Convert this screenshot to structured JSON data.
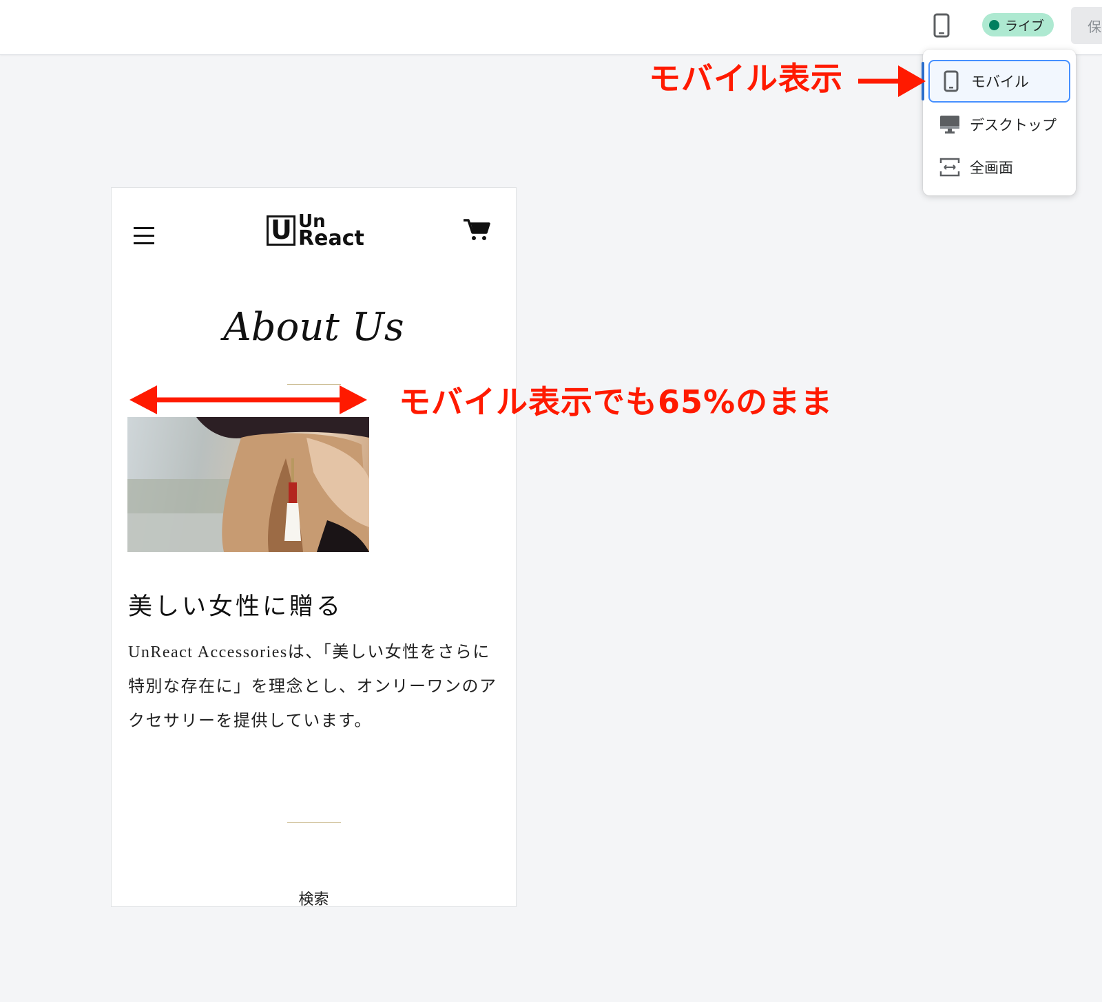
{
  "topbar": {
    "device_icon": "mobile-device-icon",
    "live_badge_label": "ライブ",
    "live_status_color": "#007f5f",
    "save_label_partial": "保"
  },
  "view_menu": {
    "items": [
      {
        "label": "モバイル",
        "icon": "mobile-icon",
        "selected": true
      },
      {
        "label": "デスクトップ",
        "icon": "desktop-icon",
        "selected": false
      },
      {
        "label": "全画面",
        "icon": "fullscreen-icon",
        "selected": false
      }
    ],
    "accent_color": "#458fff"
  },
  "preview": {
    "header": {
      "menu_icon": "hamburger-menu-icon",
      "logo_text_line1": "Un",
      "logo_text_line2": "React",
      "logo_letter": "U",
      "cart_icon": "cart-icon"
    },
    "about_title": "About Us",
    "section_heading": "美しい女性に贈る",
    "body_text": "UnReact Accessoriesは、「美しい女性をさらに特別な存在に」を理念とし、オンリーワンのアクセサリーを提供しています。",
    "search_label": "検索"
  },
  "annotations": {
    "mobile_view_label": "モバイル表示",
    "width_note": "モバイル表示でも65%のまま",
    "color": "#ff1a00"
  }
}
